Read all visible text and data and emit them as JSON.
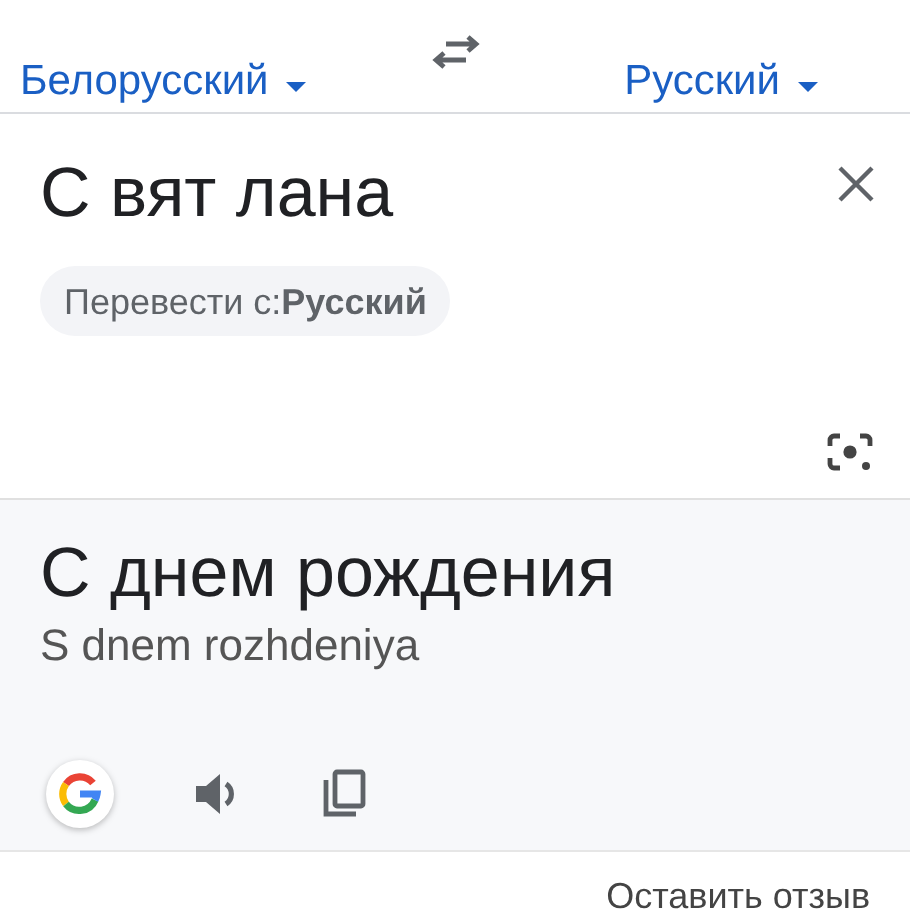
{
  "language_bar": {
    "source_language": "Белорусский",
    "target_language": "Русский"
  },
  "input": {
    "value": "С вят лана",
    "suggestion": "Перевести с:**Русский**"
  },
  "output": {
    "translation": "С днем рождения",
    "transliteration": "S dnem rozhdeniya"
  },
  "feedback_link": "Оставить отзыв"
}
